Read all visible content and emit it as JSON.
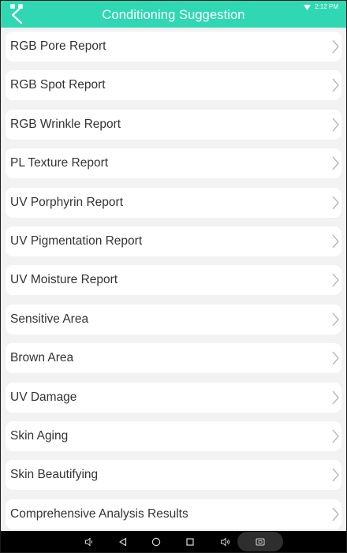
{
  "header": {
    "title": "Conditioning Suggestion",
    "status_time": "2:12 PM",
    "back_icon": "chevron-left-icon",
    "background_color": "#2fd8b2"
  },
  "list": {
    "items": [
      {
        "label": "RGB Pore Report"
      },
      {
        "label": "RGB Spot Report"
      },
      {
        "label": "RGB Wrinkle Report"
      },
      {
        "label": "PL Texture Report"
      },
      {
        "label": "UV Porphyrin Report"
      },
      {
        "label": "UV Pigmentation Report"
      },
      {
        "label": "UV Moisture Report"
      },
      {
        "label": "Sensitive Area"
      },
      {
        "label": "Brown Area"
      },
      {
        "label": "UV Damage"
      },
      {
        "label": "Skin Aging"
      },
      {
        "label": "Skin Beautifying"
      },
      {
        "label": "Comprehensive Analysis Results"
      }
    ],
    "row_icon": "chevron-right-icon"
  },
  "navbar": {
    "buttons": [
      "volume-down-icon",
      "back-triangle-icon",
      "home-circle-icon",
      "recents-square-icon",
      "volume-up-icon",
      "screenshot-icon"
    ]
  }
}
